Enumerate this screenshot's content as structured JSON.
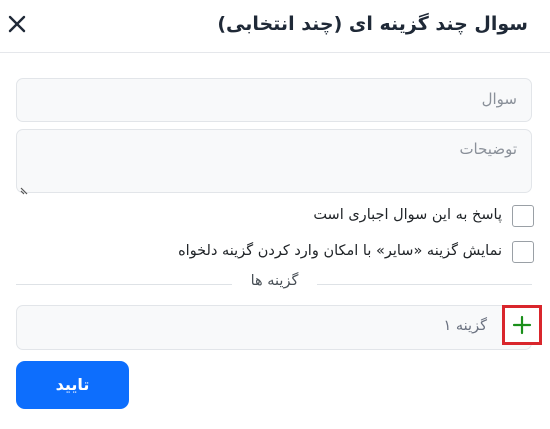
{
  "modal": {
    "title": "سوال چند گزینه ای (چند انتخابی)",
    "close_icon": "close-icon"
  },
  "form": {
    "question_placeholder": "سوال",
    "description_placeholder": "توضیحات",
    "required_label": "پاسخ به این سوال اجباری است",
    "other_option_label": "نمایش گزینه «سایر» با امکان وارد کردن گزینه دلخواه",
    "options_section_label": "گزینه ها",
    "option_1_placeholder": "گزینه ۱",
    "add_option_icon": "plus-icon",
    "submit_label": "تایید"
  },
  "colors": {
    "primary": "#0d6efd",
    "add_icon": "#1a8f1a",
    "highlight_border": "#d9262c"
  }
}
